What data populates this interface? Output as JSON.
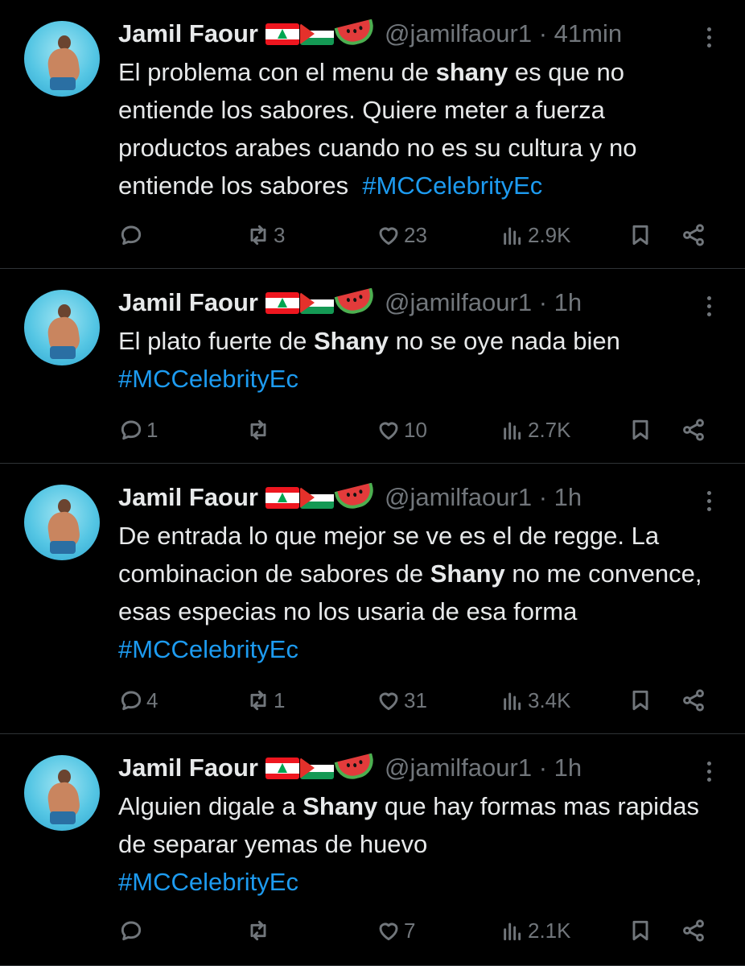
{
  "tweets": [
    {
      "name": "Jamil Faour",
      "handle": "@jamilfaour1 · 41min",
      "text_parts": [
        "El problema con el menu de ",
        "shany",
        " es que no entiende los sabores. Quiere meter a fuerza productos arabes cuando no es su cultura y no entiende los sabores  ",
        "#MCCelebrityEc"
      ],
      "replies": "",
      "reposts": "3",
      "likes": "23",
      "views": "2.9K"
    },
    {
      "name": "Jamil Faour",
      "handle": "@jamilfaour1 · 1h",
      "text_parts": [
        "El plato fuerte de ",
        "Shany",
        " no se oye nada bien\n",
        "#MCCelebrityEc"
      ],
      "replies": "1",
      "reposts": "",
      "likes": "10",
      "views": "2.7K"
    },
    {
      "name": "Jamil Faour",
      "handle": "@jamilfaour1 · 1h",
      "text_parts": [
        "De entrada lo que mejor se ve es el de regge. La combinacion de sabores de ",
        "Shany",
        " no me convence, esas especias no los usaria de esa forma ",
        "#MCCelebrityEc"
      ],
      "replies": "4",
      "reposts": "1",
      "likes": "31",
      "views": "3.4K"
    },
    {
      "name": "Jamil Faour",
      "handle": "@jamilfaour1 · 1h",
      "text_parts": [
        "Alguien digale a ",
        "Shany",
        " que hay formas mas rapidas de separar yemas de huevo\n",
        "#MCCelebrityEc"
      ],
      "replies": "",
      "reposts": "",
      "likes": "7",
      "views": "2.1K"
    }
  ],
  "badge_emojis": [
    "lebanon-flag",
    "palestine-flag",
    "watermelon"
  ],
  "colors": {
    "background": "#000000",
    "text": "#e7e9ea",
    "muted": "#71767b",
    "link": "#1d9bf0",
    "divider": "#2f3336"
  }
}
